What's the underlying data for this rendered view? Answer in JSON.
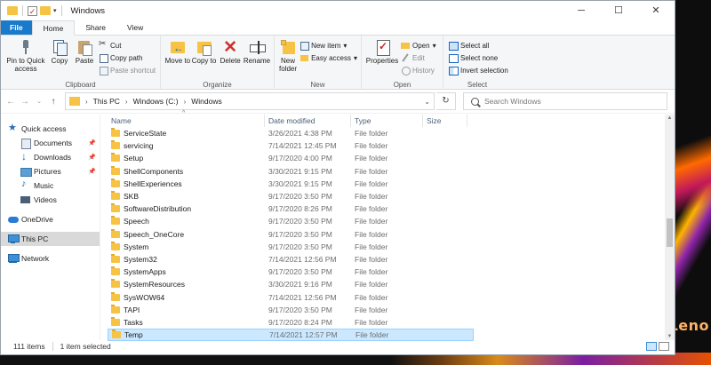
{
  "window": {
    "title": "Windows",
    "controls": {
      "minimize": "─",
      "maximize": "☐",
      "close": "✕"
    }
  },
  "tabs": [
    "File",
    "Home",
    "Share",
    "View"
  ],
  "ribbon": {
    "clipboard": {
      "label": "Clipboard",
      "pin": "Pin to Quick access",
      "copy": "Copy",
      "paste": "Paste",
      "cut": "Cut",
      "copy_path": "Copy path",
      "paste_shortcut": "Paste shortcut"
    },
    "organize": {
      "label": "Organize",
      "move_to": "Move to",
      "copy_to": "Copy to",
      "delete": "Delete",
      "rename": "Rename"
    },
    "new": {
      "label": "New",
      "new_folder": "New folder",
      "new_item": "New item",
      "easy_access": "Easy access"
    },
    "open": {
      "label": "Open",
      "properties": "Properties",
      "open": "Open",
      "edit": "Edit",
      "history": "History"
    },
    "select": {
      "label": "Select",
      "select_all": "Select all",
      "select_none": "Select none",
      "invert": "Invert selection"
    }
  },
  "address": {
    "crumbs": [
      "This PC",
      "Windows (C:)",
      "Windows"
    ]
  },
  "search": {
    "placeholder": "Search Windows"
  },
  "nav": {
    "quick_access": "Quick access",
    "items": [
      {
        "label": "Documents",
        "icon": "documents-icon",
        "pinned": true
      },
      {
        "label": "Downloads",
        "icon": "downloads-icon",
        "pinned": true
      },
      {
        "label": "Pictures",
        "icon": "pictures-icon",
        "pinned": true
      },
      {
        "label": "Music",
        "icon": "music-icon",
        "pinned": false
      },
      {
        "label": "Videos",
        "icon": "videos-icon",
        "pinned": false
      }
    ],
    "onedrive": "OneDrive",
    "this_pc": "This PC",
    "network": "Network"
  },
  "columns": {
    "name": "Name",
    "date": "Date modified",
    "type": "Type",
    "size": "Size"
  },
  "files": [
    {
      "name": "ServiceState",
      "date": "3/26/2021 4:38 PM",
      "type": "File folder"
    },
    {
      "name": "servicing",
      "date": "7/14/2021 12:45 PM",
      "type": "File folder"
    },
    {
      "name": "Setup",
      "date": "9/17/2020 4:00 PM",
      "type": "File folder"
    },
    {
      "name": "ShellComponents",
      "date": "3/30/2021 9:15 PM",
      "type": "File folder"
    },
    {
      "name": "ShellExperiences",
      "date": "3/30/2021 9:15 PM",
      "type": "File folder"
    },
    {
      "name": "SKB",
      "date": "9/17/2020 3:50 PM",
      "type": "File folder"
    },
    {
      "name": "SoftwareDistribution",
      "date": "9/17/2020 8:26 PM",
      "type": "File folder"
    },
    {
      "name": "Speech",
      "date": "9/17/2020 3:50 PM",
      "type": "File folder"
    },
    {
      "name": "Speech_OneCore",
      "date": "9/17/2020 3:50 PM",
      "type": "File folder"
    },
    {
      "name": "System",
      "date": "9/17/2020 3:50 PM",
      "type": "File folder"
    },
    {
      "name": "System32",
      "date": "7/14/2021 12:56 PM",
      "type": "File folder"
    },
    {
      "name": "SystemApps",
      "date": "9/17/2020 3:50 PM",
      "type": "File folder"
    },
    {
      "name": "SystemResources",
      "date": "3/30/2021 9:16 PM",
      "type": "File folder"
    },
    {
      "name": "SysWOW64",
      "date": "7/14/2021 12:56 PM",
      "type": "File folder"
    },
    {
      "name": "TAPI",
      "date": "9/17/2020 3:50 PM",
      "type": "File folder"
    },
    {
      "name": "Tasks",
      "date": "9/17/2020 8:24 PM",
      "type": "File folder"
    },
    {
      "name": "Temp",
      "date": "7/14/2021 12:57 PM",
      "type": "File folder",
      "selected": true
    }
  ],
  "status": {
    "count": "111 items",
    "selected": "1 item selected"
  },
  "wallpaper": {
    "brand": "Leno"
  },
  "colors": {
    "file_tab": "#1979ca",
    "selection": "#cce8ff",
    "folder": "#f6c344"
  }
}
